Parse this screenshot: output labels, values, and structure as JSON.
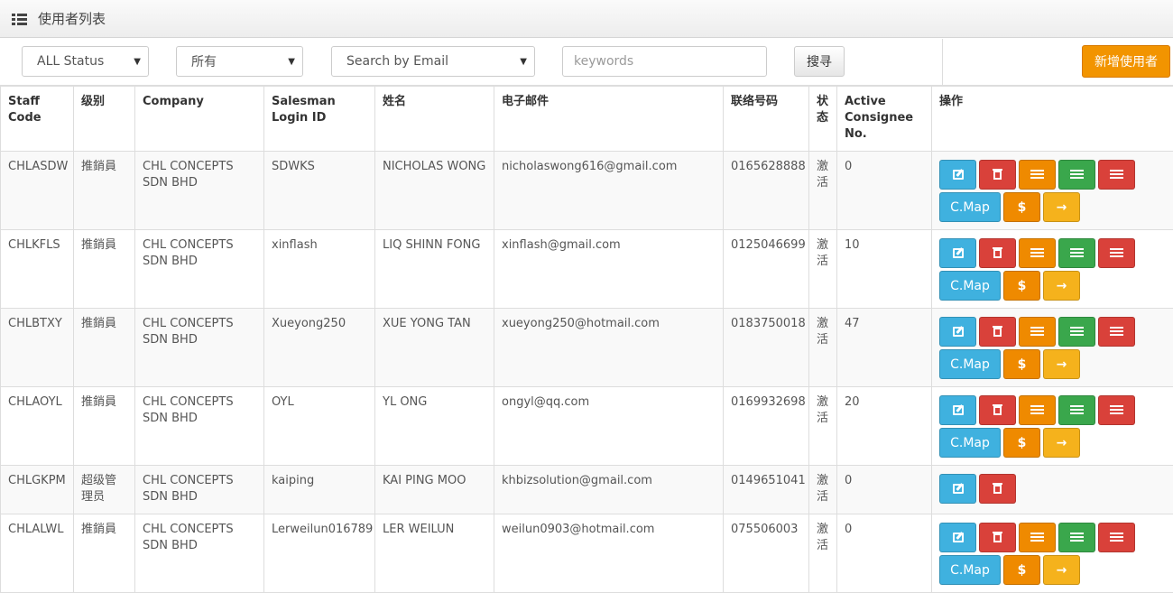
{
  "header": {
    "title": "使用者列表",
    "icon": "list-icon"
  },
  "filters": {
    "status_select": "ALL Status",
    "level_select": "所有",
    "email_select": "Search by Email",
    "keywords_placeholder": "keywords",
    "search_label": "搜寻",
    "add_user_label": "新增使用者"
  },
  "table": {
    "headers": {
      "staff_code": "Staff Code",
      "level": "级别",
      "company": "Company",
      "login_id": "Salesman Login ID",
      "name": "姓名",
      "email": "电子邮件",
      "phone": "联络号码",
      "status": "状态",
      "consignee": "Active Consignee No.",
      "actions": "操作"
    },
    "rows": [
      {
        "staff_code": "CHLASDW",
        "level": "推銷員",
        "company": "CHL CONCEPTS SDN BHD",
        "login_id": "SDWKS",
        "name": "NICHOLAS WONG",
        "email": "nicholaswong616@gmail.com",
        "phone": "0165628888",
        "status": "激活",
        "consignee": "0"
      },
      {
        "staff_code": "CHLKFLS",
        "level": "推銷員",
        "company": "CHL CONCEPTS SDN BHD",
        "login_id": "xinflash",
        "name": "LIQ SHINN FONG",
        "email": "xinflash@gmail.com",
        "phone": "0125046699",
        "status": "激活",
        "consignee": "10"
      },
      {
        "staff_code": "CHLBTXY",
        "level": "推銷員",
        "company": "CHL CONCEPTS SDN BHD",
        "login_id": "Xueyong250",
        "name": "XUE YONG TAN",
        "email": "xueyong250@hotmail.com",
        "phone": "0183750018",
        "status": "激活",
        "consignee": "47"
      },
      {
        "staff_code": "CHLAOYL",
        "level": "推銷員",
        "company": "CHL CONCEPTS SDN BHD",
        "login_id": "OYL",
        "name": "YL ONG",
        "email": "ongyl@qq.com",
        "phone": "0169932698",
        "status": "激活",
        "consignee": "20"
      },
      {
        "staff_code": "CHLGKPM",
        "level": "超级管理员",
        "company": "CHL CONCEPTS SDN BHD",
        "login_id": "kaiping",
        "name": "KAI PING MOO",
        "email": "khbizsolution@gmail.com",
        "phone": "0149651041",
        "status": "激活",
        "consignee": "0"
      },
      {
        "staff_code": "CHLALWL",
        "level": "推銷員",
        "company": "CHL CONCEPTS SDN BHD",
        "login_id": "Lerweilun016789",
        "name": "LER WEILUN",
        "email": "weilun0903@hotmail.com",
        "phone": "075506003",
        "status": "激活",
        "consignee": "0"
      }
    ],
    "action_labels": {
      "cmap": "C.Map",
      "dollar": "$",
      "arrow": "→"
    }
  },
  "colors": {
    "blue": "#3fb1df",
    "red": "#d9413a",
    "orange": "#ef8a00",
    "green": "#3aa74c",
    "yellow": "#f5b21c",
    "add_button": "#f29400"
  }
}
